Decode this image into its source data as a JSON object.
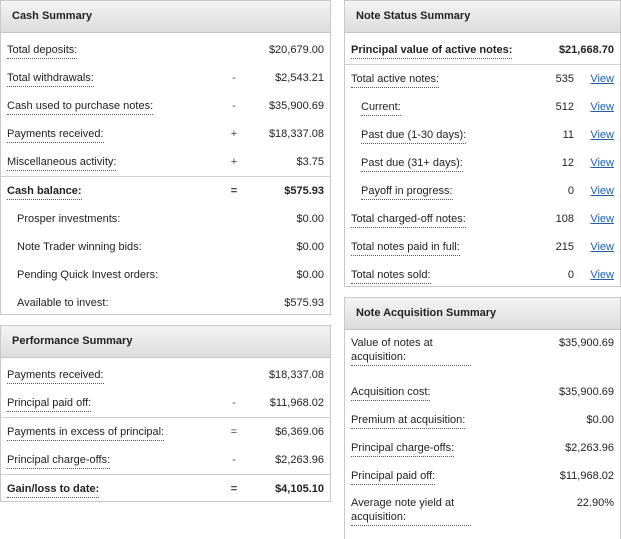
{
  "cash": {
    "title": "Cash Summary",
    "rows": [
      {
        "label": "Total deposits:",
        "sym": "",
        "value": "$20,679.00"
      },
      {
        "label": "Total withdrawals:",
        "sym": "-",
        "value": "$2,543.21"
      },
      {
        "label": "Cash used to purchase notes:",
        "sym": "-",
        "value": "$35,900.69"
      },
      {
        "label": "Payments received:",
        "sym": "+",
        "value": "$18,337.08"
      },
      {
        "label": "Miscellaneous activity:",
        "sym": "+",
        "value": "$3.75"
      },
      {
        "label": "Cash balance:",
        "sym": "=",
        "value": "$575.93"
      },
      {
        "label": "Prosper investments:",
        "sym": "",
        "value": "$0.00"
      },
      {
        "label": "Note Trader winning bids:",
        "sym": "",
        "value": "$0.00"
      },
      {
        "label": "Pending Quick Invest orders:",
        "sym": "",
        "value": "$0.00"
      },
      {
        "label": "Available to invest:",
        "sym": "",
        "value": "$575.93"
      }
    ]
  },
  "performance": {
    "title": "Performance Summary",
    "rows": [
      {
        "label": "Payments received:",
        "sym": "",
        "value": "$18,337.08"
      },
      {
        "label": "Principal paid off:",
        "sym": "-",
        "value": "$11,968.02"
      },
      {
        "label": "Payments in excess of principal:",
        "sym": "=",
        "value": "$6,369.06"
      },
      {
        "label": "Principal charge-offs:",
        "sym": "-",
        "value": "$2,263.96"
      },
      {
        "label": "Gain/loss to date:",
        "sym": "=",
        "value": "$4,105.10"
      }
    ]
  },
  "note_status": {
    "title": "Note Status Summary",
    "view_label": "View",
    "rows": [
      {
        "label": "Principal value of active notes:",
        "value": "$21,668.70"
      },
      {
        "label": "Total active notes:",
        "value": "535"
      },
      {
        "label": "Current:",
        "value": "512"
      },
      {
        "label": "Past due (1-30 days):",
        "value": "11"
      },
      {
        "label": "Past due (31+ days):",
        "value": "12"
      },
      {
        "label": "Payoff in progress:",
        "value": "0"
      },
      {
        "label": "Total charged-off notes:",
        "value": "108"
      },
      {
        "label": "Total notes paid in full:",
        "value": "215"
      },
      {
        "label": "Total notes sold:",
        "value": "0"
      }
    ]
  },
  "acquisition": {
    "title": "Note Acquisition Summary",
    "rows": [
      {
        "label": "Value of notes at acquisition:",
        "value": "$35,900.69"
      },
      {
        "label": "Acquisition cost:",
        "value": "$35,900.69"
      },
      {
        "label": "Premium at acquisition:",
        "value": "$0.00"
      },
      {
        "label": "Principal charge-offs:",
        "value": "$2,263.96"
      },
      {
        "label": "Principal paid off:",
        "value": "$11,968.02"
      },
      {
        "label": "Average note yield at acquisition:",
        "value": "22.90%"
      }
    ]
  }
}
